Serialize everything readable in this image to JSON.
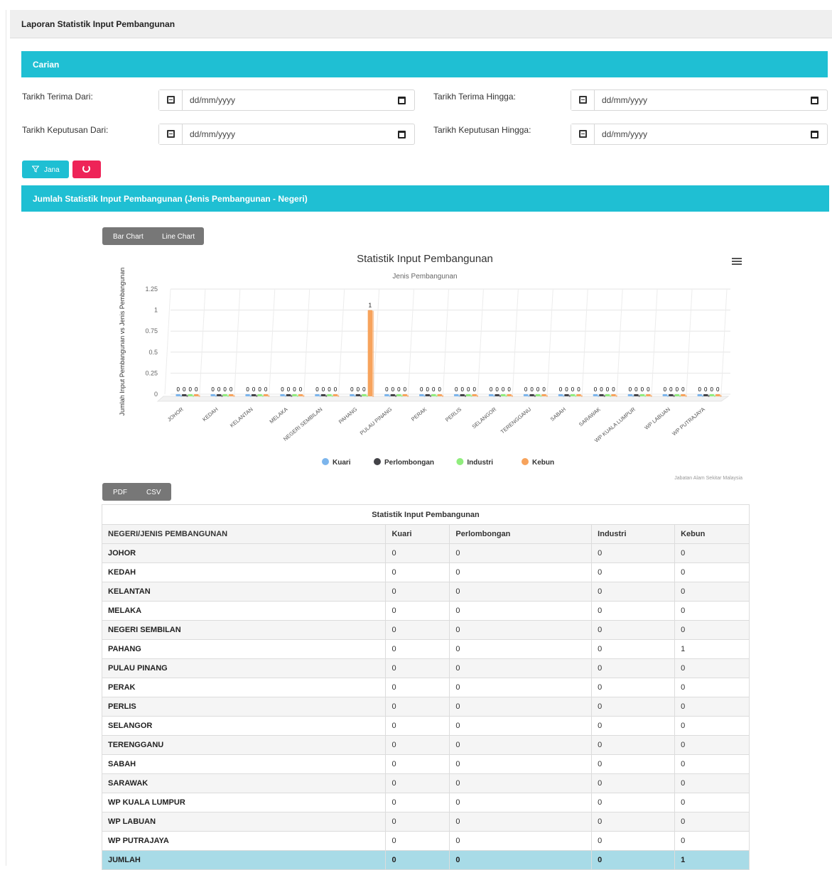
{
  "header": {
    "title": "Laporan Statistik Input Pembangunan"
  },
  "search": {
    "title": "Carian",
    "fields": [
      {
        "label": "Tarikh Terima Dari:",
        "placeholder": "dd/mm/yyyy"
      },
      {
        "label": "Tarikh Terima Hingga:",
        "placeholder": "dd/mm/yyyy"
      },
      {
        "label": "Tarikh Keputusan Dari:",
        "placeholder": "dd/mm/yyyy"
      },
      {
        "label": "Tarikh Keputusan Hingga:",
        "placeholder": "dd/mm/yyyy"
      }
    ],
    "jana_label": "Jana",
    "accent": "#1fbfd3",
    "reset_color": "#ee2458",
    "icons": {
      "date_addon": "calendar-icon",
      "date_picker": "calendar-picker-icon",
      "jana": "filter-icon",
      "reset": "refresh-icon"
    }
  },
  "section": {
    "title": "Jumlah Statistik Input Pembangunan (Jenis Pembangunan - Negeri)"
  },
  "chart_toggle": {
    "bar_label": "Bar Chart",
    "line_label": "Line Chart"
  },
  "export": {
    "pdf_label": "PDF",
    "csv_label": "CSV"
  },
  "chart_data": {
    "type": "bar",
    "title": "Statistik Input Pembangunan",
    "subtitle": "Jenis Pembangunan",
    "ylabel": "Jumlah Input Pembangunan vs Jenis Pembangunan",
    "xlabel": "",
    "ylim": [
      0,
      1.25
    ],
    "yticks": [
      "0",
      "0.25",
      "0.5",
      "0.75",
      "1",
      "1.25"
    ],
    "credits": "Jabatan Alam Sekitar Malaysia",
    "grid": true,
    "legend_position": "bottom",
    "categories": [
      "JOHOR",
      "KEDAH",
      "KELANTAN",
      "MELAKA",
      "NEGERI SEMBILAN",
      "PAHANG",
      "PULAU PINANG",
      "PERAK",
      "PERLIS",
      "SELANGOR",
      "TERENGGANU",
      "SABAH",
      "SARAWAK",
      "WP KUALA LUMPUR",
      "WP LABUAN",
      "WP PUTRAJAYA"
    ],
    "series": [
      {
        "name": "Kuari",
        "color": "#7cb5ec",
        "values": [
          0,
          0,
          0,
          0,
          0,
          0,
          0,
          0,
          0,
          0,
          0,
          0,
          0,
          0,
          0,
          0
        ]
      },
      {
        "name": "Perlombongan",
        "color": "#434348",
        "values": [
          0,
          0,
          0,
          0,
          0,
          0,
          0,
          0,
          0,
          0,
          0,
          0,
          0,
          0,
          0,
          0
        ]
      },
      {
        "name": "Industri",
        "color": "#90ed7d",
        "values": [
          0,
          0,
          0,
          0,
          0,
          0,
          0,
          0,
          0,
          0,
          0,
          0,
          0,
          0,
          0,
          0
        ]
      },
      {
        "name": "Kebun",
        "color": "#f7a35c",
        "values": [
          0,
          0,
          0,
          0,
          0,
          1,
          0,
          0,
          0,
          0,
          0,
          0,
          0,
          0,
          0,
          0
        ]
      }
    ]
  },
  "table": {
    "caption": "Statistik Input Pembangunan",
    "headers": [
      "NEGERI/JENIS PEMBANGUNAN",
      "Kuari",
      "Perlombongan",
      "Industri",
      "Kebun"
    ],
    "rows": [
      [
        "JOHOR",
        "0",
        "0",
        "0",
        "0"
      ],
      [
        "KEDAH",
        "0",
        "0",
        "0",
        "0"
      ],
      [
        "KELANTAN",
        "0",
        "0",
        "0",
        "0"
      ],
      [
        "MELAKA",
        "0",
        "0",
        "0",
        "0"
      ],
      [
        "NEGERI SEMBILAN",
        "0",
        "0",
        "0",
        "0"
      ],
      [
        "PAHANG",
        "0",
        "0",
        "0",
        "1"
      ],
      [
        "PULAU PINANG",
        "0",
        "0",
        "0",
        "0"
      ],
      [
        "PERAK",
        "0",
        "0",
        "0",
        "0"
      ],
      [
        "PERLIS",
        "0",
        "0",
        "0",
        "0"
      ],
      [
        "SELANGOR",
        "0",
        "0",
        "0",
        "0"
      ],
      [
        "TERENGGANU",
        "0",
        "0",
        "0",
        "0"
      ],
      [
        "SABAH",
        "0",
        "0",
        "0",
        "0"
      ],
      [
        "SARAWAK",
        "0",
        "0",
        "0",
        "0"
      ],
      [
        "WP KUALA LUMPUR",
        "0",
        "0",
        "0",
        "0"
      ],
      [
        "WP LABUAN",
        "0",
        "0",
        "0",
        "0"
      ],
      [
        "WP PUTRAJAYA",
        "0",
        "0",
        "0",
        "0"
      ]
    ],
    "total": [
      "JUMLAH",
      "0",
      "0",
      "0",
      "1"
    ],
    "total_color": "#a8dbe7"
  }
}
